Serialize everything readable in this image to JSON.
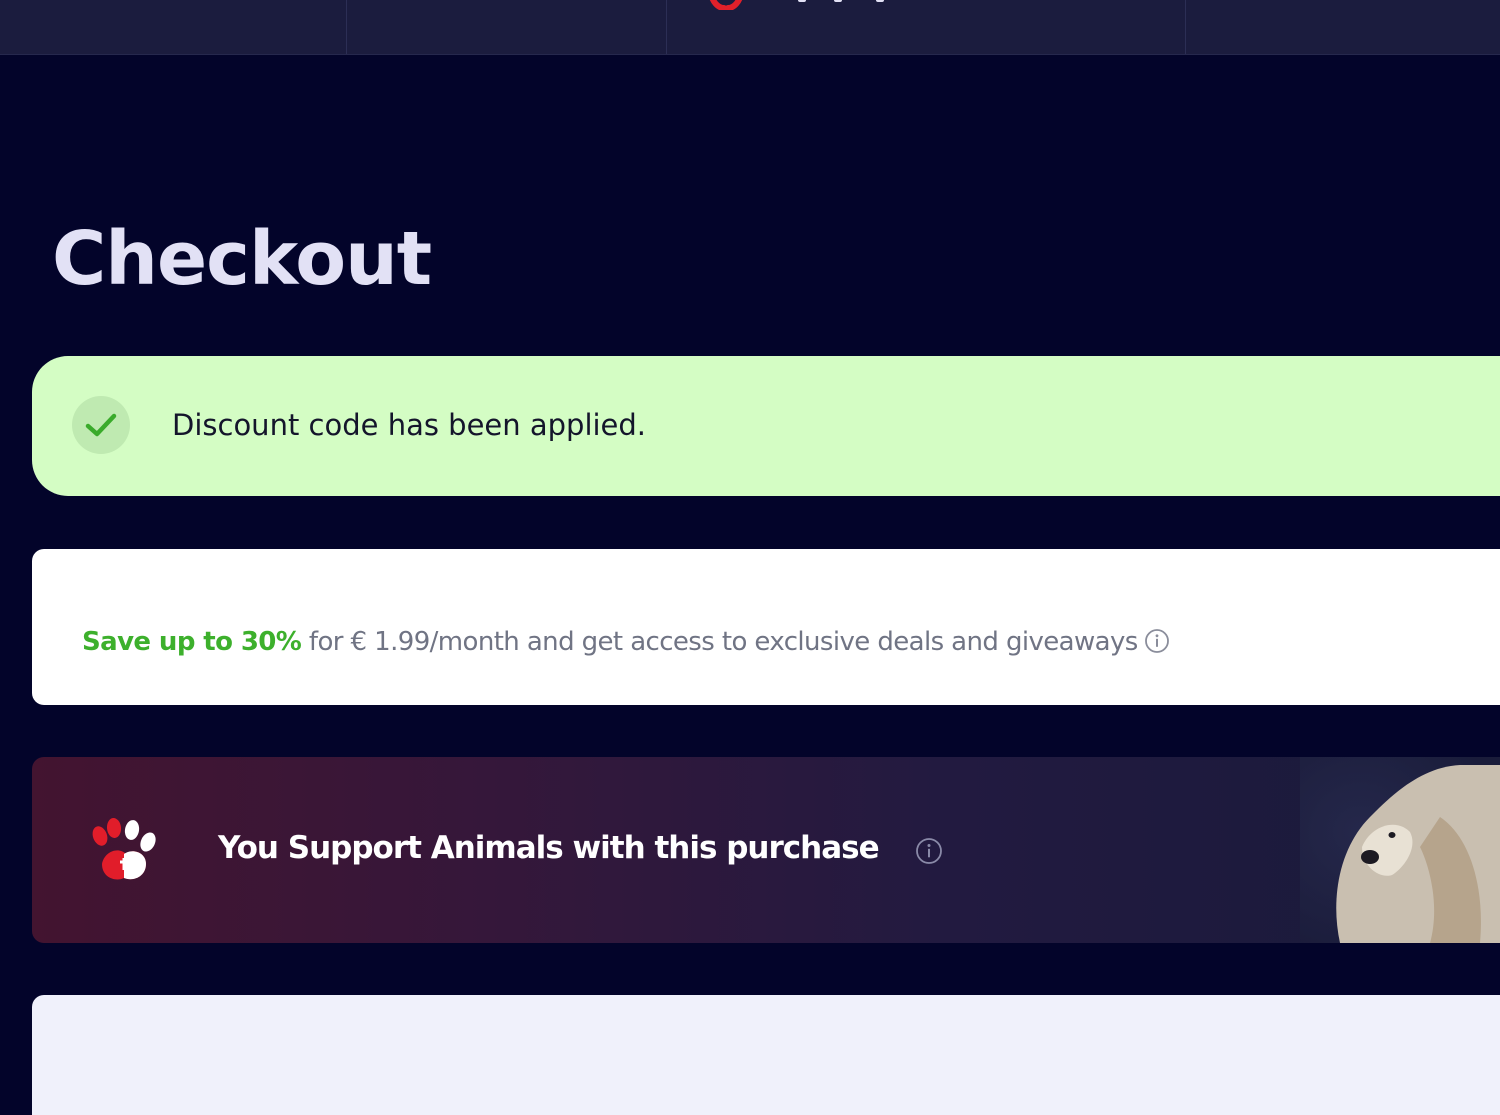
{
  "page": {
    "title": "Checkout"
  },
  "alert": {
    "message": "Discount code has been applied.",
    "icon": "check-icon",
    "color": "#d4fdc4"
  },
  "promo": {
    "highlight": "Save up to 30%",
    "text": " for € 1.99/month and get access to exclusive deals and giveaways",
    "highlight_color": "#3db02c",
    "icon": "info-icon"
  },
  "support": {
    "text": "You Support Animals with this purchase",
    "icon": "paw-icon",
    "info_icon": "info-icon"
  },
  "colors": {
    "background": "#03042a",
    "header": "#1b1c3e",
    "title": "#e2e1f5"
  }
}
